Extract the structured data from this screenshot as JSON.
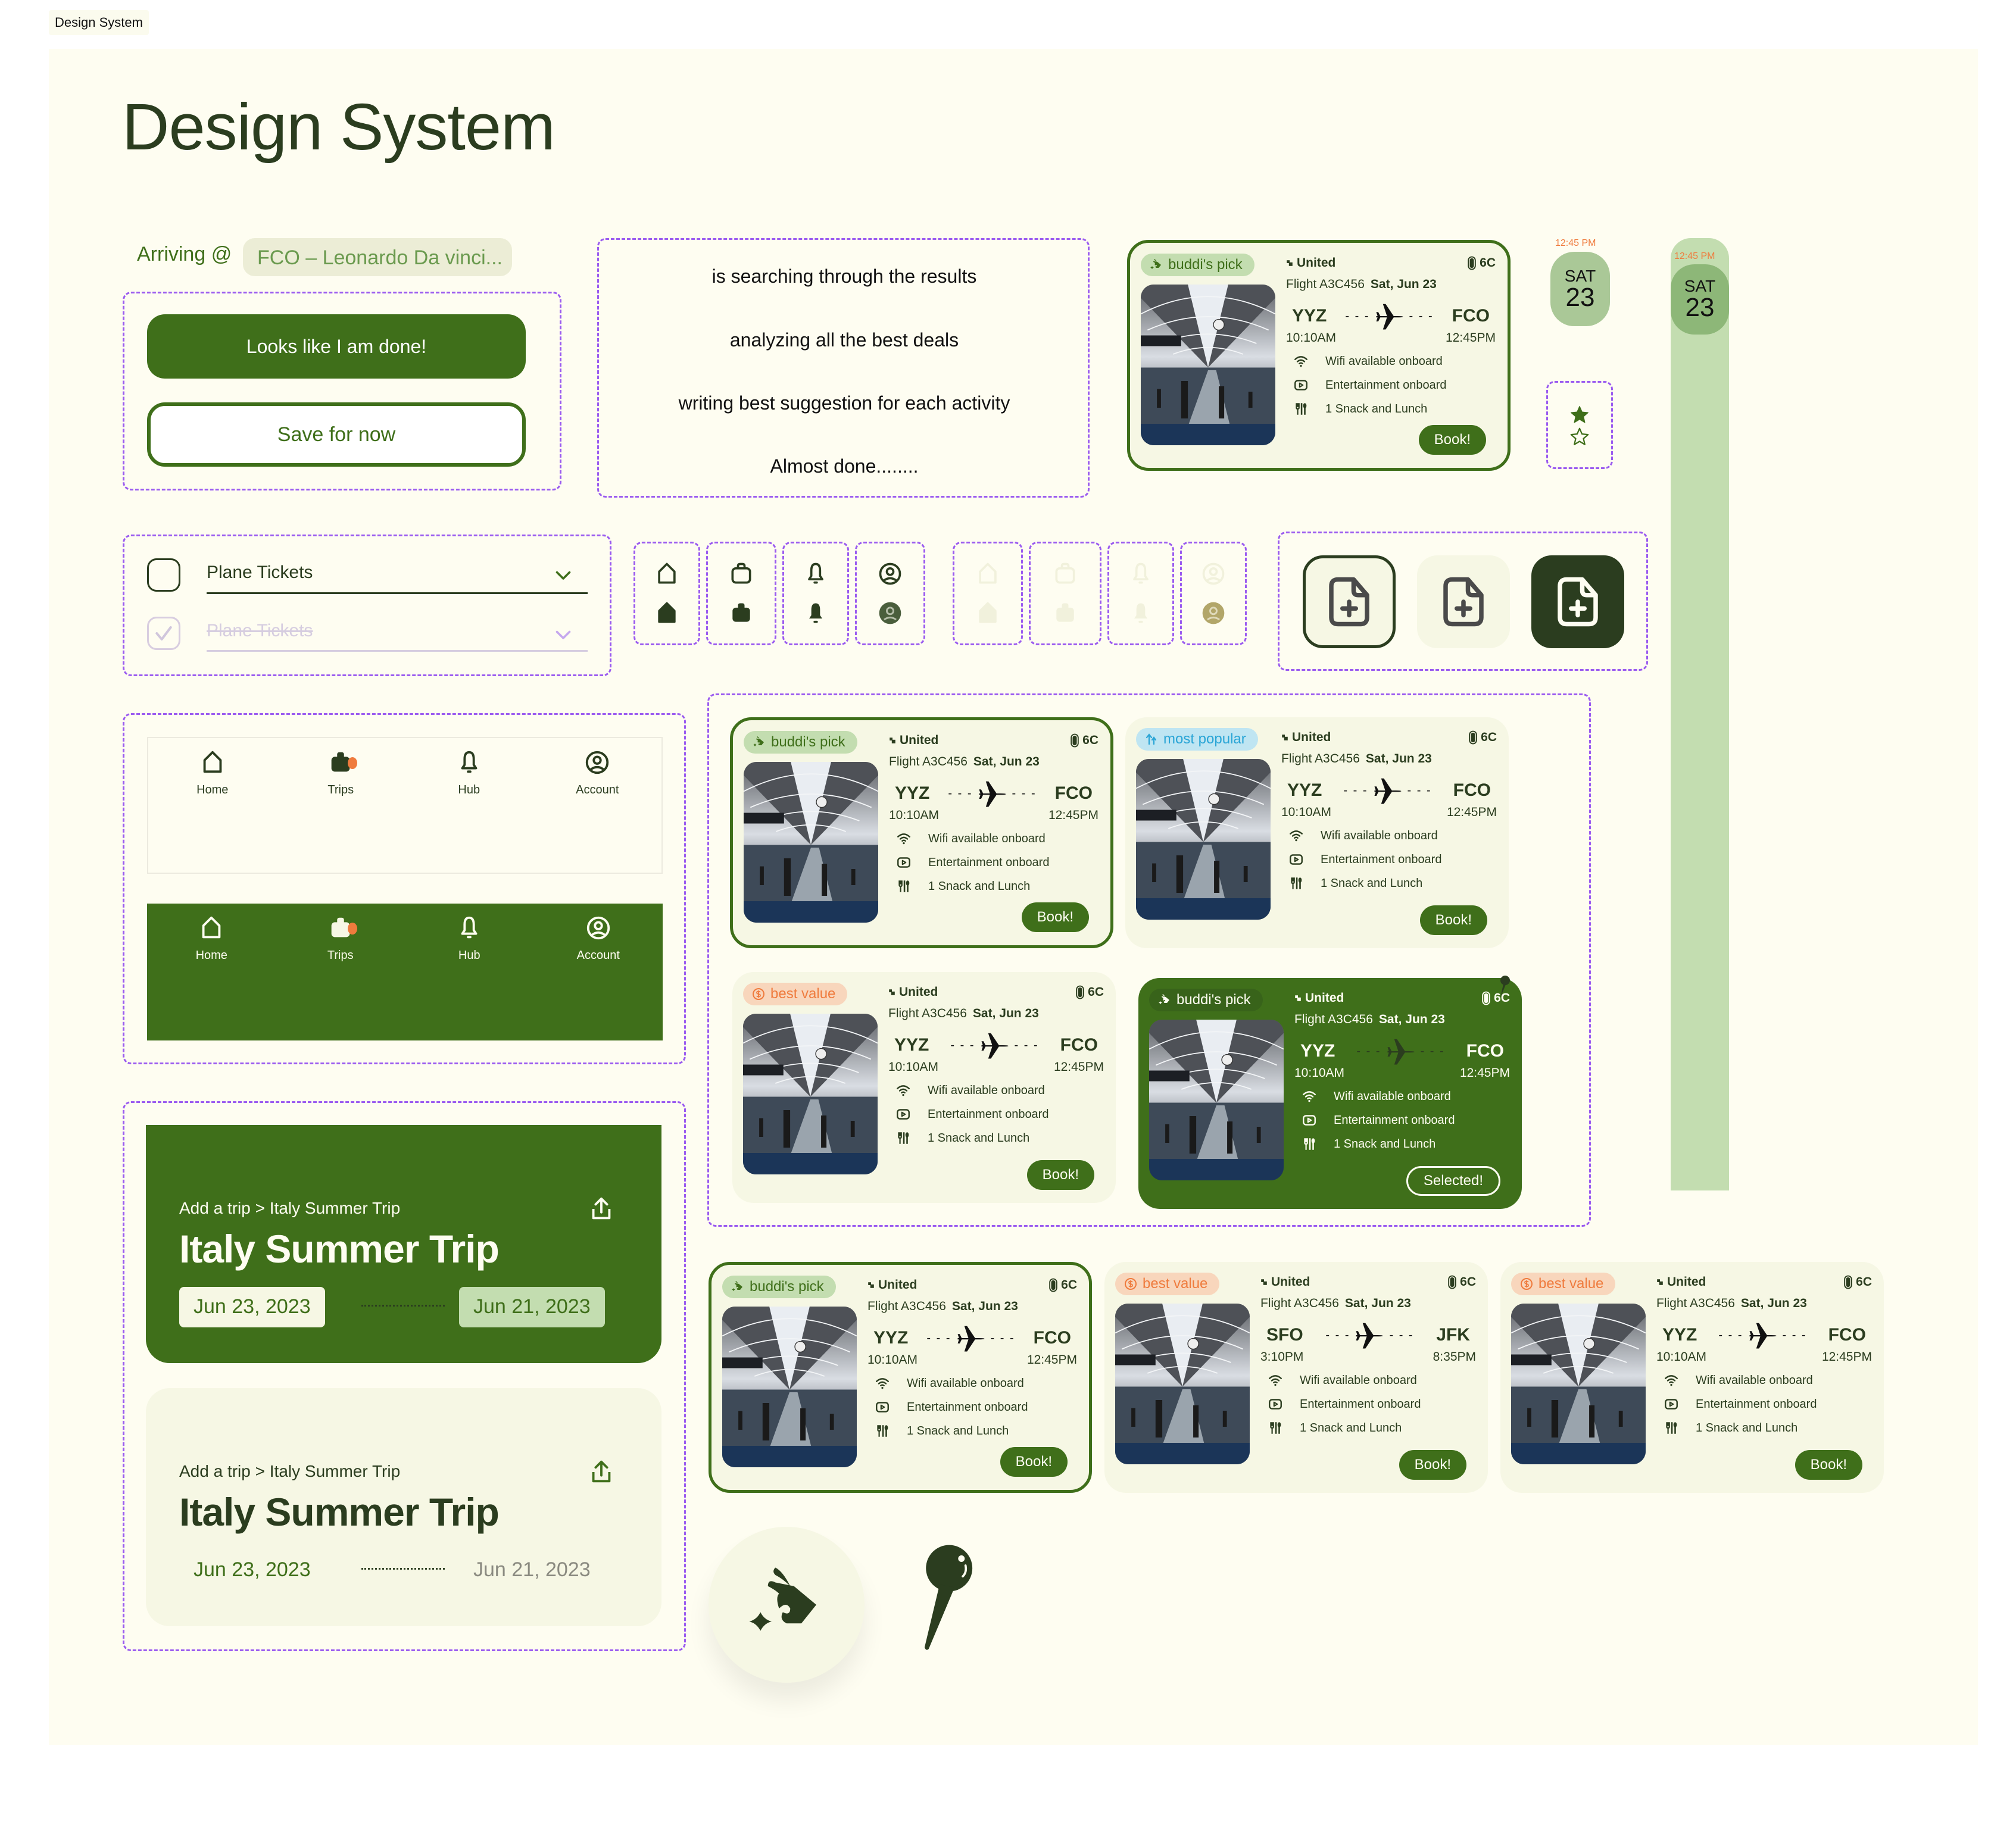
{
  "frame_label": "Design System",
  "page_title": "Design System",
  "arriving": {
    "label": "Arriving @",
    "value": "FCO – Leonardo Da vinci..."
  },
  "buttons": {
    "primary": "Looks like I am done!",
    "secondary": "Save for now"
  },
  "status_messages": [
    "is searching through the results",
    "analyzing all the best deals",
    "writing best suggestion for each activity",
    "Almost done........"
  ],
  "dropdowns": [
    {
      "label": "Plane Tickets",
      "state": "unchecked"
    },
    {
      "label": "Plane Tickets",
      "state": "checked-disabled"
    }
  ],
  "icon_set": [
    "home-icon",
    "trips-icon",
    "bell-icon",
    "account-icon"
  ],
  "rating": {
    "filled": 1,
    "empty": 1
  },
  "date_chip": {
    "time": "12:45 PM",
    "weekday": "SAT",
    "day": "23"
  },
  "nav": {
    "items": [
      {
        "label": "Home",
        "icon": "home-icon"
      },
      {
        "label": "Trips",
        "icon": "trips-icon",
        "badge": true
      },
      {
        "label": "Hub",
        "icon": "bell-icon"
      },
      {
        "label": "Account",
        "icon": "account-icon"
      }
    ]
  },
  "trip_cards": [
    {
      "breadcrumb": "Add a trip > Italy Summer Trip",
      "title": "Italy Summer Trip",
      "start": "Jun 23, 2023",
      "end": "Jun 21, 2023",
      "theme": "dark"
    },
    {
      "breadcrumb": "Add a trip > Italy Summer Trip",
      "title": "Italy Summer Trip",
      "start": "Jun 23, 2023",
      "end": "Jun 21, 2023",
      "theme": "light"
    }
  ],
  "flight_common": {
    "airline": "United",
    "seat": "6C",
    "flight_label": "Flight A3C456",
    "date": "Sat, Jun 23",
    "amenities": [
      "Wifi available onboard",
      "Entertainment onboard",
      "1 Snack and Lunch"
    ]
  },
  "flights": [
    {
      "badge": "buddi's pick",
      "from": "YYZ",
      "to": "FCO",
      "dep": "10:10AM",
      "arr": "12:45PM",
      "action": "Book!"
    },
    {
      "badge": "buddi's pick",
      "from": "YYZ",
      "to": "FCO",
      "dep": "10:10AM",
      "arr": "12:45PM",
      "action": "Book!"
    },
    {
      "badge": "most popular",
      "from": "YYZ",
      "to": "FCO",
      "dep": "10:10AM",
      "arr": "12:45PM",
      "action": "Book!"
    },
    {
      "badge": "best value",
      "from": "YYZ",
      "to": "FCO",
      "dep": "10:10AM",
      "arr": "12:45PM",
      "action": "Book!"
    },
    {
      "badge": "buddi's pick",
      "from": "YYZ",
      "to": "FCO",
      "dep": "10:10AM",
      "arr": "12:45PM",
      "action": "Selected!"
    },
    {
      "badge": "buddi's pick",
      "from": "YYZ",
      "to": "FCO",
      "dep": "10:10AM",
      "arr": "12:45PM",
      "action": "Book!"
    },
    {
      "badge": "best value",
      "from": "SFO",
      "to": "JFK",
      "dep": "3:10PM",
      "arr": "8:35PM",
      "action": "Book!"
    },
    {
      "badge": "best value",
      "from": "YYZ",
      "to": "FCO",
      "dep": "10:10AM",
      "arr": "12:45PM",
      "action": "Book!"
    }
  ],
  "colors": {
    "primary": "#3f6f1a",
    "dark": "#2b3d1f",
    "background": "#fefdf1",
    "card": "#f6f7e4",
    "accent_orange": "#ef7b3d",
    "accent_blue": "#2aa5d6",
    "light_green": "#c3ddb0"
  },
  "standalone_icons": [
    "buddi-logo-icon",
    "pushpin-icon"
  ]
}
